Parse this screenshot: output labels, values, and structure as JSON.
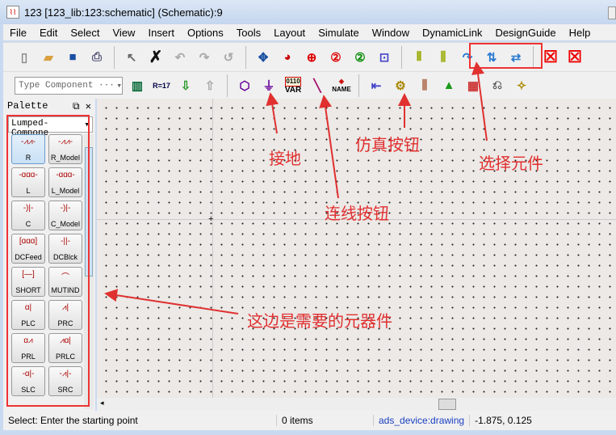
{
  "window": {
    "title": "123 [123_lib:123:schematic] (Schematic):9",
    "icon": "ads-schematic-icon"
  },
  "menu": [
    "File",
    "Edit",
    "Select",
    "View",
    "Insert",
    "Options",
    "Tools",
    "Layout",
    "Simulate",
    "Window",
    "DynamicLink",
    "DesignGuide",
    "Help"
  ],
  "toolbar2": {
    "type_component": "Type Component ···",
    "var_label": "VAR",
    "var_top": "0110",
    "name_label": "NAME",
    "r17": "R=17"
  },
  "palette": {
    "title": "Palette",
    "library": "Lumped-Compone",
    "items": [
      {
        "label": "R",
        "sym": "-⩘⩘-"
      },
      {
        "label": "R_Model",
        "sym": "-⩘⩘-"
      },
      {
        "label": "L",
        "sym": "-ɑɑɑ-"
      },
      {
        "label": "L_Model",
        "sym": "-ɑɑɑ-"
      },
      {
        "label": "C",
        "sym": "-)|-"
      },
      {
        "label": "C_Model",
        "sym": "-)|-"
      },
      {
        "label": "DCFeed",
        "sym": "[ɑɑɑ]"
      },
      {
        "label": "DCBlck",
        "sym": "-||-"
      },
      {
        "label": "SHORT",
        "sym": "[—]"
      },
      {
        "label": "MUTIND",
        "sym": "⌒"
      },
      {
        "label": "PLC",
        "sym": "ɑ|"
      },
      {
        "label": "PRC",
        "sym": "⩘|"
      },
      {
        "label": "PRL",
        "sym": "ɑ⩘"
      },
      {
        "label": "PRLC",
        "sym": "⩘ɑ|"
      },
      {
        "label": "SLC",
        "sym": "-ɑ|-"
      },
      {
        "label": "SRC",
        "sym": "-⩘|-"
      }
    ]
  },
  "status": {
    "message": "Select: Enter the starting point",
    "items": "0 items",
    "layer": "ads_device:drawing",
    "coords": "-1.875, 0.125"
  },
  "annotations": {
    "ground": "接地",
    "sim": "仿真按钮",
    "select": "选择元件",
    "wire": "连线按钮",
    "components": "这边是需要的元器件"
  },
  "colors": {
    "annotation": "#e03030"
  }
}
